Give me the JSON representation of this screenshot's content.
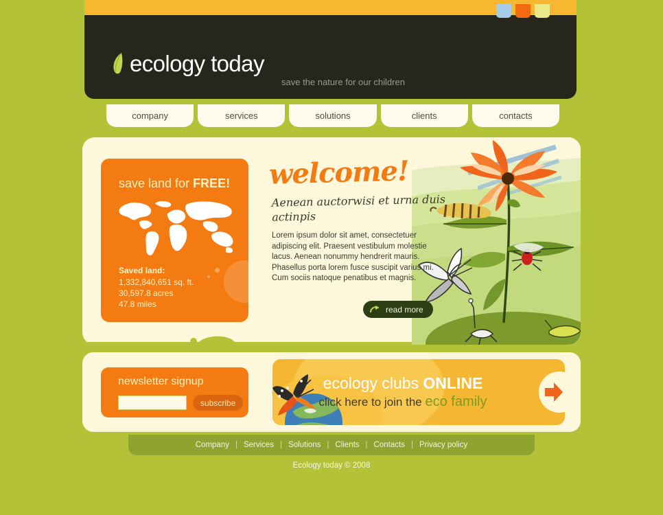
{
  "site": {
    "background_color": "#b4c238",
    "panel_color": "#fdf8dc",
    "orange": "#f47b12",
    "yellow": "#f5b731",
    "dark_header": "#26261c",
    "dark_green": "#2d3d14"
  },
  "topbar": {
    "swatches": [
      {
        "name": "color-swatch-blue",
        "color": "#a8cbe8"
      },
      {
        "name": "color-swatch-orange",
        "color": "#f46a10"
      },
      {
        "name": "color-swatch-yellow",
        "color": "#ebe888"
      }
    ]
  },
  "header": {
    "logo_icon": "leaf-icon",
    "logo_text": "ecology today",
    "tagline": "save the nature for our children"
  },
  "nav": {
    "items": [
      {
        "label": "company"
      },
      {
        "label": "services"
      },
      {
        "label": "solutions"
      },
      {
        "label": "clients"
      },
      {
        "label": "contacts"
      }
    ]
  },
  "promo": {
    "title_prefix": "save land for ",
    "title_emphasis": "FREE!",
    "map_icon": "world-map-icon",
    "saved_label": "Saved land:",
    "saved_values": [
      "1,332,840,651 sq. ft.",
      "30,597.8 acres",
      "47.8 miles"
    ]
  },
  "welcome": {
    "heading": "welcome!",
    "subheading": "Aenean auctorwisi et urna duis actinpis",
    "body": "Lorem ipsum dolor sit amet, consectetuer adipiscing elit. Praesent vestibulum molestie lacus. Aenean nonummy hendrerit mauris. Phasellus porta lorem fusce suscipit varius mi.",
    "body_line2": "Cum sociis natoque penatibus et magnis.",
    "read_more_label": "read more",
    "read_more_icon": "curved-arrow-icon",
    "illustration": "nature-illustration-flower-butterfly-caterpillar"
  },
  "newsletter": {
    "title": "newsletter signup",
    "input_value": "",
    "input_placeholder": "",
    "subscribe_label": "subscribe"
  },
  "clubs": {
    "line1_prefix": "ecology clubs ",
    "line1_emphasis": "ONLINE",
    "line2_prefix": "click here to join the ",
    "line2_emphasis": "eco family",
    "arrow_icon": "right-arrow-icon",
    "image": "butterfly-on-globe-icon"
  },
  "footer": {
    "links": [
      {
        "label": "Company"
      },
      {
        "label": "Services"
      },
      {
        "label": "Solutions"
      },
      {
        "label": "Clients"
      },
      {
        "label": "Contacts"
      },
      {
        "label": "Privacy policy"
      }
    ],
    "separator": "|",
    "copyright": "Ecology today © 2008"
  }
}
